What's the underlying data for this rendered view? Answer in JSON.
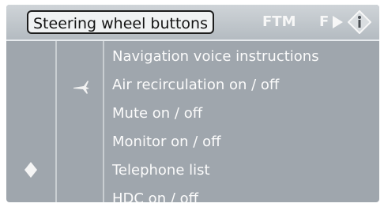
{
  "header": {
    "tabs": [
      {
        "label": "Steering wheel buttons",
        "active": true
      },
      {
        "label": "FTM"
      },
      {
        "label": "F"
      }
    ]
  },
  "menu": {
    "items": [
      {
        "label": "Navigation voice instructions"
      },
      {
        "label": "Air recirculation on / off"
      },
      {
        "label": "Mute on / off"
      },
      {
        "label": "Monitor on / off"
      },
      {
        "label": "Telephone list"
      },
      {
        "label": "HDC on / off"
      }
    ]
  },
  "icons": {
    "next": "play-arrow-icon",
    "info": "info-icon",
    "item_marker": "plane-icon",
    "selection": "diamond-icon"
  },
  "colors": {
    "background": "#9fa6ad",
    "header": "#c3c9ce",
    "text": "#fbfbfb",
    "active_tab": "#f0f2f3"
  }
}
